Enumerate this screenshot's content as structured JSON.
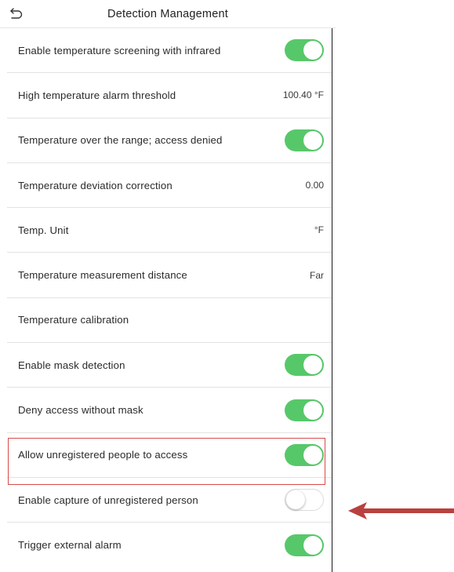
{
  "header": {
    "title": "Detection Management"
  },
  "rows": [
    {
      "label": "Enable temperature screening with infrared",
      "toggle": "on"
    },
    {
      "label": "High temperature alarm threshold",
      "value": "100.40 °F"
    },
    {
      "label": "Temperature over the range; access denied",
      "toggle": "on"
    },
    {
      "label": "Temperature deviation correction",
      "value": "0.00"
    },
    {
      "label": "Temp. Unit",
      "value": "°F"
    },
    {
      "label": "Temperature measurement distance",
      "value": "Far"
    },
    {
      "label": "Temperature calibration"
    },
    {
      "label": "Enable mask detection",
      "toggle": "on"
    },
    {
      "label": "Deny access without mask",
      "toggle": "on"
    },
    {
      "label": "Allow unregistered people to access",
      "toggle": "on"
    },
    {
      "label": "Enable capture of unregistered person",
      "toggle": "off"
    },
    {
      "label": "Trigger external alarm",
      "toggle": "on"
    }
  ],
  "colors": {
    "toggle_on": "#57c86a",
    "highlight": "#d84a4a",
    "arrow": "#b8413f"
  },
  "icons": {
    "back": "back-arrow-icon",
    "pointer": "left-arrow-icon"
  }
}
